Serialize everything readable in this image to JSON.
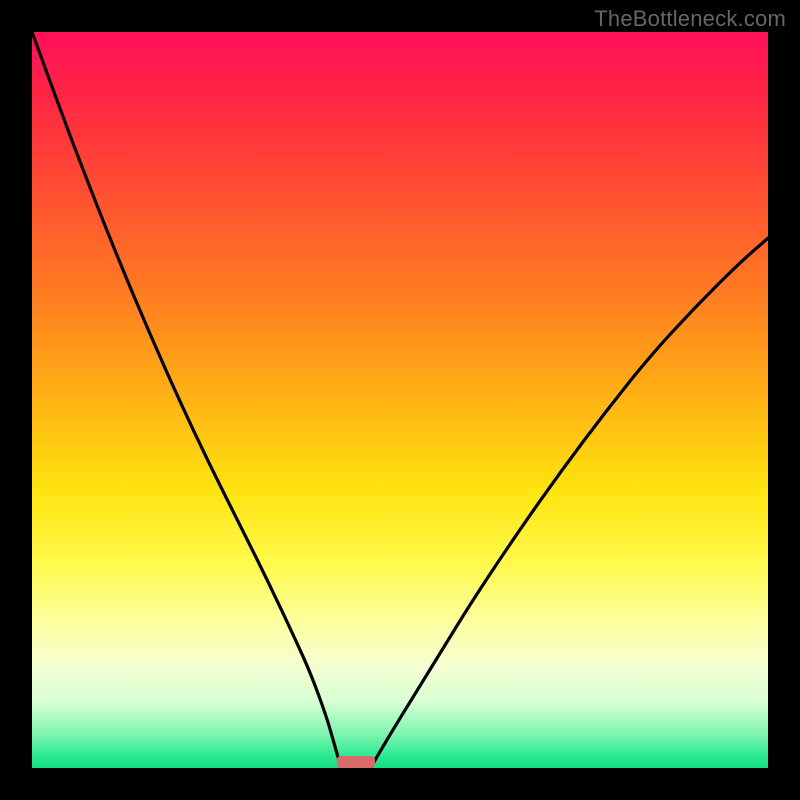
{
  "watermark": "TheBottleneck.com",
  "colors": {
    "frame": "#000000",
    "watermark": "#666666",
    "curve": "#000000",
    "marker_fill": "#d86a6a",
    "gradient_stops": [
      {
        "offset": 0.0,
        "color": "#ff105a"
      },
      {
        "offset": 0.08,
        "color": "#ff2345"
      },
      {
        "offset": 0.2,
        "color": "#ff4a33"
      },
      {
        "offset": 0.35,
        "color": "#ff7a22"
      },
      {
        "offset": 0.5,
        "color": "#ffb315"
      },
      {
        "offset": 0.62,
        "color": "#ffe30f"
      },
      {
        "offset": 0.72,
        "color": "#fff94a"
      },
      {
        "offset": 0.8,
        "color": "#fcff9e"
      },
      {
        "offset": 0.86,
        "color": "#f5ffd0"
      },
      {
        "offset": 0.91,
        "color": "#d8ffd4"
      },
      {
        "offset": 0.955,
        "color": "#7cf5b0"
      },
      {
        "offset": 0.985,
        "color": "#29e98f"
      },
      {
        "offset": 1.0,
        "color": "#14df84"
      }
    ]
  },
  "chart_data": {
    "type": "line",
    "title": "",
    "xlabel": "",
    "ylabel": "",
    "xlim": [
      0,
      100
    ],
    "ylim": [
      0,
      100
    ],
    "grid": false,
    "legend": false,
    "series": [
      {
        "name": "left-branch",
        "x": [
          0,
          4,
          8,
          12,
          16,
          20,
          24,
          28,
          32,
          36,
          38,
          40,
          41,
          42
        ],
        "y": [
          100,
          89,
          78.5,
          68.5,
          59,
          50,
          41.5,
          33.5,
          25.5,
          17,
          12.5,
          7,
          3.5,
          0
        ]
      },
      {
        "name": "right-branch",
        "x": [
          46,
          48,
          52,
          56,
          60,
          66,
          72,
          78,
          84,
          90,
          96,
          100
        ],
        "y": [
          0,
          3.5,
          10,
          16.5,
          23,
          32,
          40.5,
          48.5,
          56,
          62.5,
          68.5,
          72
        ]
      }
    ],
    "marker": {
      "x_center": 44,
      "x_halfwidth": 2.6,
      "y": 0
    }
  }
}
